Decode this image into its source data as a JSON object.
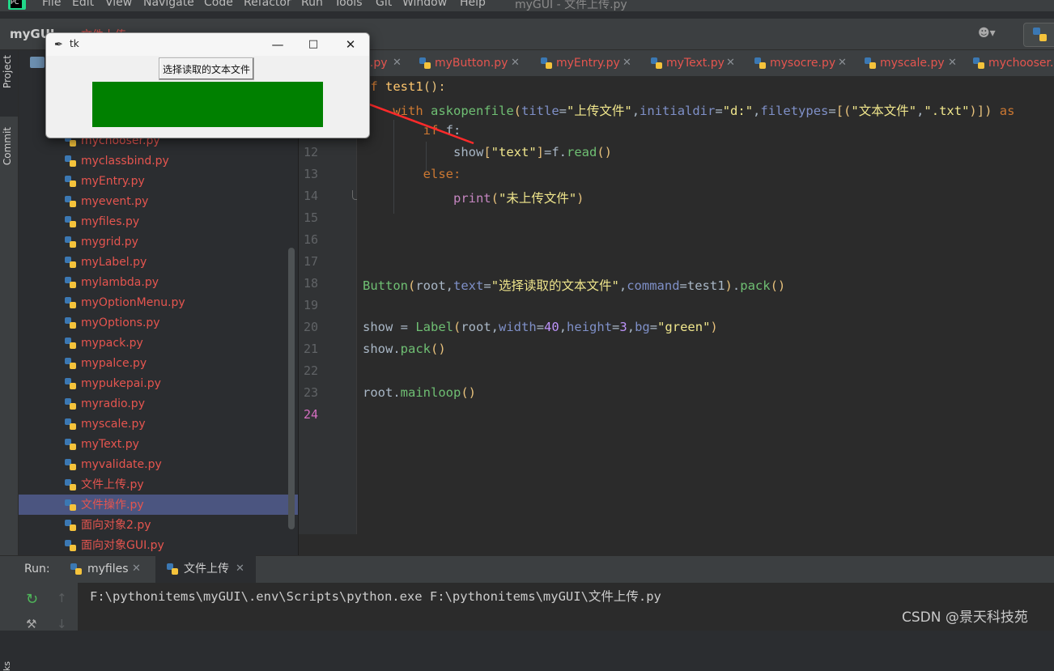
{
  "menubar": {
    "items": [
      "File",
      "Edit",
      "View",
      "Navigate",
      "Code",
      "Refactor",
      "Run",
      "Tools",
      "Git",
      "Window",
      "Help"
    ],
    "window_title": "myGUI - 文件上传.py"
  },
  "navbar": {
    "project": "myGUI",
    "breadcrumb_file": "文件上传.py"
  },
  "left_strip": {
    "project_label": "Project",
    "commit_label": "Commit",
    "bookmarks_label": "ks"
  },
  "project_files": [
    "mychooser.py",
    "myclassbind.py",
    "myEntry.py",
    "myevent.py",
    "myfiles.py",
    "mygrid.py",
    "myLabel.py",
    "mylambda.py",
    "myOptionMenu.py",
    "myOptions.py",
    "mypack.py",
    "mypalce.py",
    "mypukepai.py",
    "myradio.py",
    "myscale.py",
    "myText.py",
    "myvalidate.py",
    "文件上传.py",
    "文件操作.py",
    "面向对象2.py",
    "面向对象GUI.py"
  ],
  "selected_file": "文件操作.py",
  "editor_tabs": [
    {
      "label": "l.py"
    },
    {
      "label": "myButton.py"
    },
    {
      "label": "myEntry.py"
    },
    {
      "label": "myText.py"
    },
    {
      "label": "mysocre.py"
    },
    {
      "label": "myscale.py"
    },
    {
      "label": "mychooser.py"
    }
  ],
  "line_numbers": [
    "12",
    "13",
    "14",
    "15",
    "16",
    "17",
    "18",
    "19",
    "20",
    "21",
    "22",
    "23",
    "24"
  ],
  "current_line": "24",
  "code": {
    "l1_def": "ef",
    "l1_name": "test1",
    "l1_rest": "():",
    "l2_with": "with",
    "l2_fn": "askopenfile",
    "l2_title_p": "title",
    "l2_title_v": "\"上传文件\"",
    "l2_dir_p": "initialdir",
    "l2_dir_v": "\"d:\"",
    "l2_ft_p": "filetypes",
    "l2_ft_v1": "\"文本文件\"",
    "l2_ft_v2": "\".txt\"",
    "l2_tail": "as",
    "l3_if": "if",
    "l3_rest": " f:",
    "l4_show": "show",
    "l4_key": "\"text\"",
    "l4_rest": "=f.",
    "l4_read": "read",
    "l5_else": "else:",
    "l6_print": "print",
    "l6_str": "\"未上传文件\"",
    "l18_button": "Button",
    "l18_root": "root,",
    "l18_text_p": "text",
    "l18_text_v": "\"选择读取的文本文件\"",
    "l18_cmd_p": "command",
    "l18_cmd_v": "test1",
    "l18_pack": "pack",
    "l20_show": "show = ",
    "l20_label": "Label",
    "l20_root": "root,",
    "l20_w_p": "width",
    "l20_w_v": "40",
    "l20_h_p": "height",
    "l20_h_v": "3",
    "l20_bg_p": "bg",
    "l20_bg_v": "\"green\"",
    "l21_show": "show.",
    "l21_pack": "pack",
    "l23_root": "root.",
    "l23_mainloop": "mainloop"
  },
  "run_panel": {
    "label": "Run:",
    "tabs": [
      {
        "label": "myfiles"
      },
      {
        "label": "文件上传"
      }
    ],
    "console_output": "F:\\pythonitems\\myGUI\\.env\\Scripts\\python.exe F:\\pythonitems\\myGUI\\文件上传.py"
  },
  "watermark": "CSDN @景天科技苑",
  "tk_window": {
    "title": "tk",
    "button_label": "选择读取的文本文件",
    "label_bg": "#008000"
  },
  "colors": {
    "accent_red": "#e5554f",
    "arrow": "#ff2a2a",
    "selection": "#4b5580"
  },
  "icons": [
    "python-file-icon",
    "close-icon",
    "minimize-icon",
    "maximize-icon",
    "feather-icon",
    "user-icon",
    "run-icon",
    "wrench-icon"
  ]
}
